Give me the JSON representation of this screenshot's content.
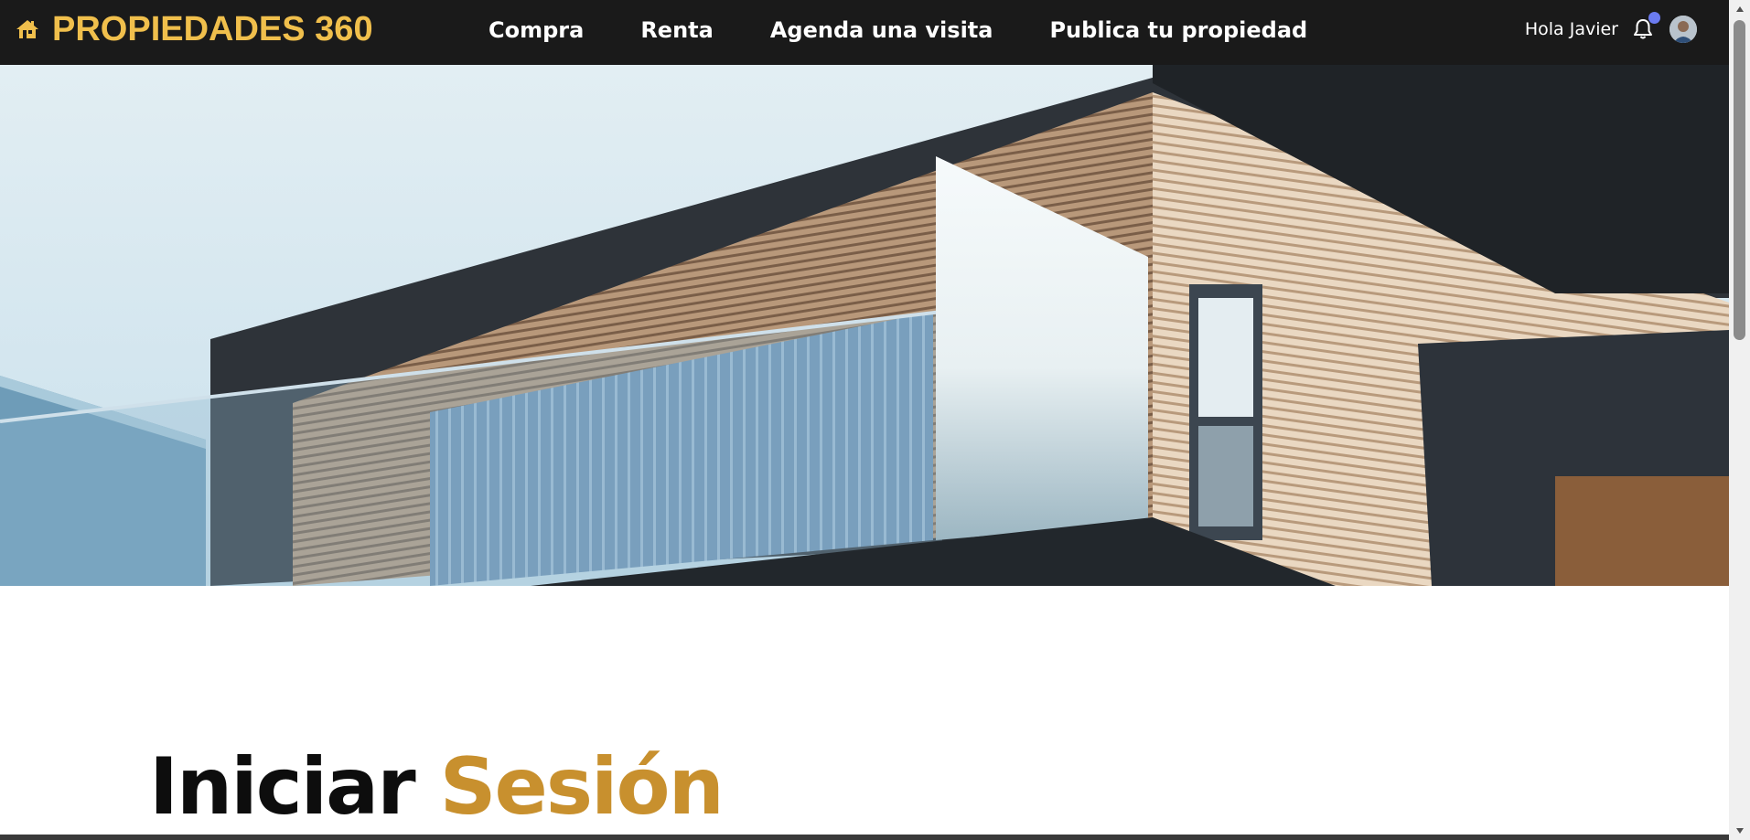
{
  "navbar": {
    "brand_icon": "house-icon",
    "brand_name": "PROPIEDADES 360",
    "links": [
      "Compra",
      "Renta",
      "Agenda una visita",
      "Publica tu propiedad"
    ],
    "greeting": "Hola Javier",
    "bell_icon": "bell-icon",
    "avatar": "user-avatar"
  },
  "hero": {
    "image": "modern-house-photo"
  },
  "login": {
    "title_main": "Iniciar",
    "title_accent": "Sesión"
  },
  "colors": {
    "navbar_bg": "#1a1a1a",
    "brand": "#f0bf4c",
    "accent": "#c8902e",
    "notification": "#6b7bf0"
  }
}
